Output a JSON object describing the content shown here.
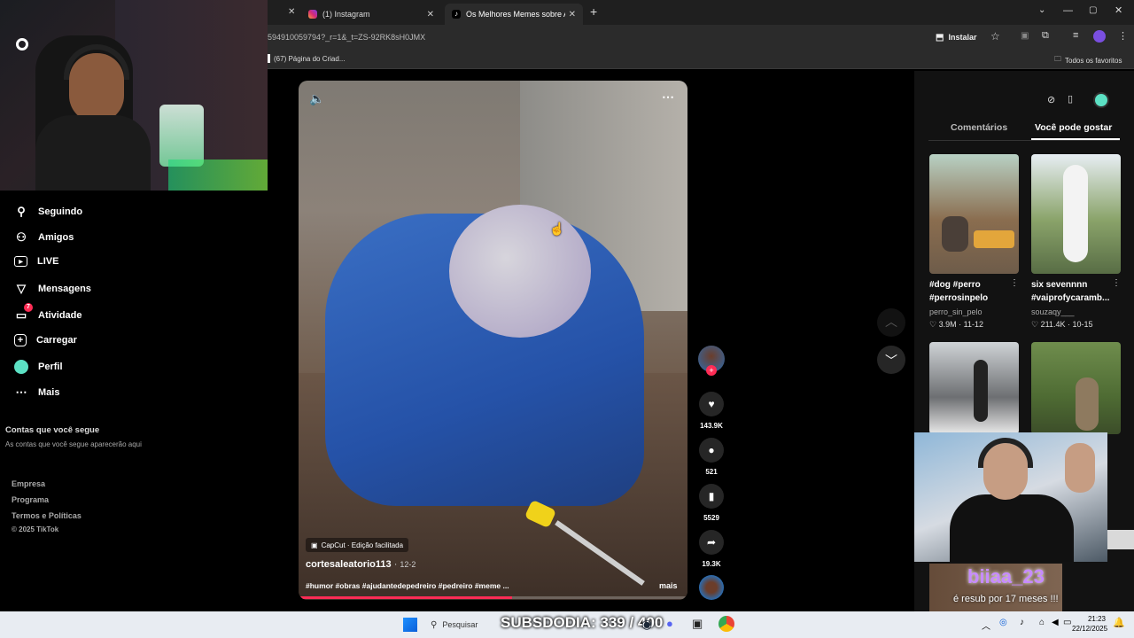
{
  "browser": {
    "tabs": [
      {
        "label": "(1) Instagram",
        "icon": "instagram-icon"
      },
      {
        "label": "Os Melhores Memes sobre Aju",
        "icon": "tiktok-icon"
      }
    ],
    "new_tab": "+",
    "url": "594910059794?_r=1&_t=ZS-92RK8sH0JMX",
    "install_label": "Instalar",
    "bookmark_1": "(67) Página do Criad...",
    "all_favorites": "Todos os favoritos"
  },
  "sidebar": {
    "items": [
      {
        "label": "Seguindo",
        "icon": "following-icon"
      },
      {
        "label": "Amigos",
        "icon": "friends-icon"
      },
      {
        "label": "LIVE",
        "icon": "live-icon"
      },
      {
        "label": "Mensagens",
        "icon": "messages-icon"
      },
      {
        "label": "Atividade",
        "icon": "activity-icon",
        "badge": "7"
      },
      {
        "label": "Carregar",
        "icon": "upload-icon"
      },
      {
        "label": "Perfil",
        "icon": "profile-icon"
      },
      {
        "label": "Mais",
        "icon": "more-icon"
      }
    ],
    "following_title": "Contas que você segue",
    "following_sub": "As contas que você segue aparecerão aqui",
    "footer": [
      "Empresa",
      "Programa",
      "Termos e Políticas",
      "© 2025 TikTok"
    ]
  },
  "video": {
    "capcut_label": "CapCut · Edição facilitada",
    "author": "cortesaleatorio113",
    "date": "12-2",
    "hashtags": "#humor #obras #ajudantedepedreiro #pedreiro #meme ...",
    "more_label": "mais",
    "progress": 0.55
  },
  "actions": {
    "likes": "143.9K",
    "comments": "521",
    "saves": "5529",
    "shares": "19.3K"
  },
  "right_panel": {
    "tabs": [
      "Comentários",
      "Você pode gostar"
    ],
    "cards": [
      {
        "title": "#dog #perro #perrosinpelo",
        "user": "perro_sin_pelo",
        "likes": "3.9M",
        "date": "11-12"
      },
      {
        "title": "six sevennnn #vaiprofycaramb...",
        "user": "souzaqy___",
        "likes": "211.4K",
        "date": "10-15"
      }
    ]
  },
  "stream": {
    "sub_name": "biiaa_23",
    "sub_text": "é resub por 17 meses !!!",
    "subsdodia": "SUBSDODIA: 339 / 400"
  },
  "taskbar": {
    "search_placeholder": "Pesquisar",
    "time": "21:23",
    "date": "22/12/2025"
  },
  "colors": {
    "tiktok_red": "#fe2c55",
    "accent_teal": "#5ce1c4",
    "stream_purple": "#c78bff"
  }
}
